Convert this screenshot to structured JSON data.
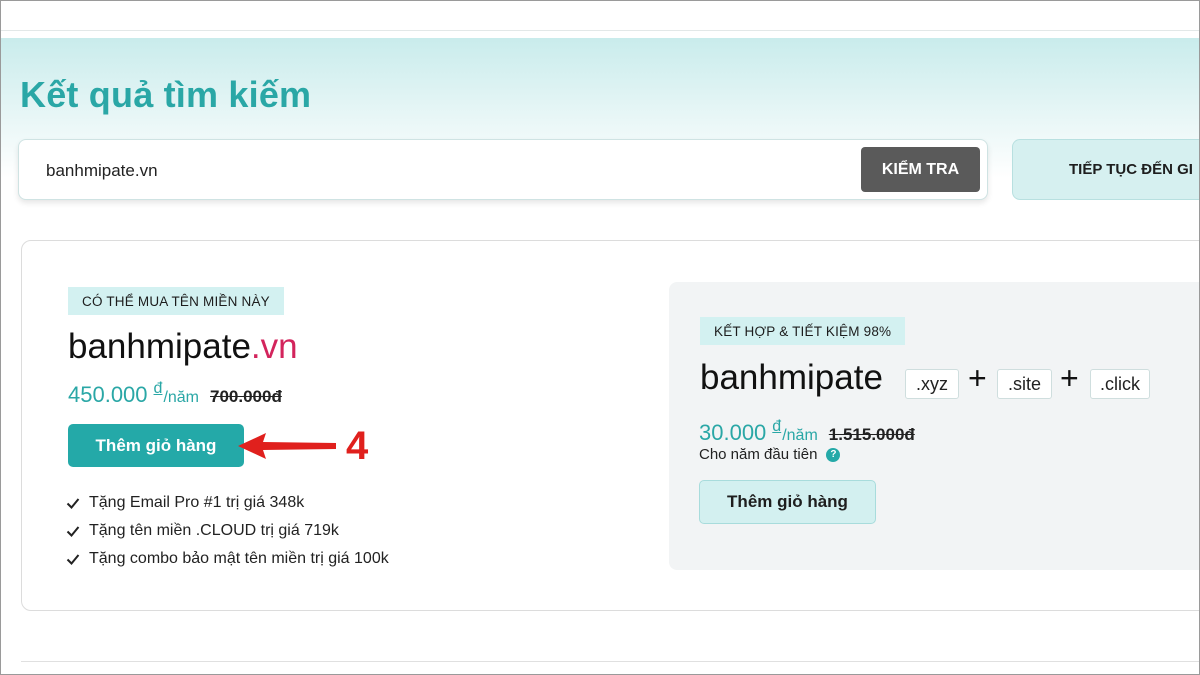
{
  "header": {
    "title": "Kết quả tìm kiếm"
  },
  "search": {
    "value": "banhmipate.vn",
    "check_label": "KIỂM TRA",
    "continue_label": "TIẾP TỤC ĐẾN GI"
  },
  "result": {
    "badge": "CÓ THỂ MUA TÊN MIỀN NÀY",
    "domain_name": "banhmipate",
    "domain_ext": ".vn",
    "price": "450.000",
    "currency": "đ",
    "per": "/năm",
    "old_price": "700.000đ",
    "add_label": "Thêm giỏ hàng",
    "benefits": [
      "Tặng Email Pro #1 trị giá 348k",
      "Tặng tên miền .CLOUD trị giá 719k",
      "Tặng combo bảo mật tên miền trị giá 100k"
    ]
  },
  "annotation": {
    "step": "4",
    "color": "#e0201d"
  },
  "combo": {
    "badge": "KẾT HỢP & TIẾT KIỆM 98%",
    "name": "banhmipate",
    "tlds": [
      ".xyz",
      ".site",
      ".click"
    ],
    "plus": "+",
    "price": "30.000",
    "currency": "đ",
    "per": "/năm",
    "old_price": "1.515.000đ",
    "note": "Cho năm đầu tiên",
    "help": "?",
    "add_label": "Thêm giỏ hàng"
  },
  "colors": {
    "accent": "#2aa7a6",
    "button": "#24a9a8",
    "domain_ext": "#d3245c",
    "check_button": "#5a5a5a"
  }
}
